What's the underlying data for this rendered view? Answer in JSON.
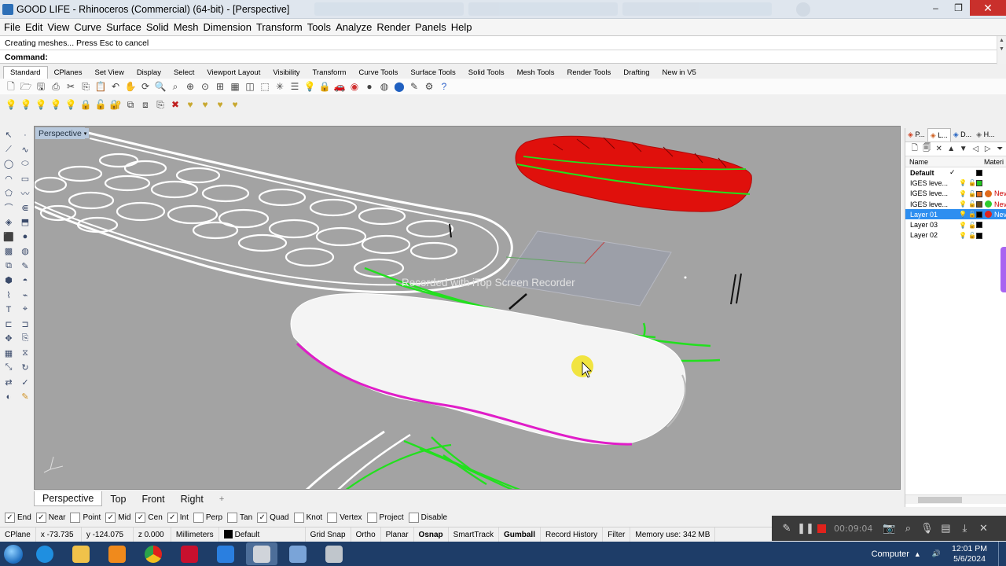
{
  "titlebar": {
    "title": "GOOD LIFE - Rhinoceros (Commercial) (64-bit) - [Perspective]"
  },
  "menu": [
    "File",
    "Edit",
    "View",
    "Curve",
    "Surface",
    "Solid",
    "Mesh",
    "Dimension",
    "Transform",
    "Tools",
    "Analyze",
    "Render",
    "Panels",
    "Help"
  ],
  "command": {
    "history": "Creating meshes... Press Esc to cancel",
    "prompt": "Command:",
    "value": ""
  },
  "toolbar_tabs": [
    "Standard",
    "CPlanes",
    "Set View",
    "Display",
    "Select",
    "Viewport Layout",
    "Visibility",
    "Transform",
    "Curve Tools",
    "Surface Tools",
    "Solid Tools",
    "Mesh Tools",
    "Render Tools",
    "Drafting",
    "New in V5"
  ],
  "active_toolbar_tab": "Standard",
  "viewport": {
    "name": "Perspective",
    "watermark": "Recorded with iTop Screen Recorder"
  },
  "viewport_tabs": [
    "Perspective",
    "Top",
    "Front",
    "Right"
  ],
  "active_viewport_tab": "Perspective",
  "panel": {
    "tabs": [
      "P...",
      "L...",
      "D...",
      "H..."
    ],
    "columns": {
      "name": "Name",
      "material": "Materi"
    },
    "layers": [
      {
        "name": "Default",
        "current": "✓",
        "color": "#000000",
        "material": "",
        "material_name": ""
      },
      {
        "name": "IGES leve...",
        "current": "",
        "color": "#22c51e",
        "material": "",
        "material_name": ""
      },
      {
        "name": "IGES leve...",
        "current": "",
        "color": "#e06a1c",
        "material": "#e06a1c",
        "material_name": "Nev"
      },
      {
        "name": "IGES leve...",
        "current": "",
        "color": "#6a4d1d",
        "material": "#2ecc2e",
        "material_name": "Nev"
      },
      {
        "name": "Layer 01",
        "current": "",
        "color": "#000000",
        "material": "#e0221c",
        "material_name": "Nev"
      },
      {
        "name": "Layer 03",
        "current": "",
        "color": "#000000",
        "material": "",
        "material_name": ""
      },
      {
        "name": "Layer 02",
        "current": "",
        "color": "#000000",
        "material": "",
        "material_name": ""
      }
    ],
    "selected_layer": "Layer 01"
  },
  "osnap": [
    {
      "label": "End",
      "checked": true
    },
    {
      "label": "Near",
      "checked": true
    },
    {
      "label": "Point",
      "checked": false
    },
    {
      "label": "Mid",
      "checked": true
    },
    {
      "label": "Cen",
      "checked": true
    },
    {
      "label": "Int",
      "checked": true
    },
    {
      "label": "Perp",
      "checked": false
    },
    {
      "label": "Tan",
      "checked": false
    },
    {
      "label": "Quad",
      "checked": true
    },
    {
      "label": "Knot",
      "checked": false
    },
    {
      "label": "Vertex",
      "checked": false
    },
    {
      "label": "Project",
      "checked": false
    },
    {
      "label": "Disable",
      "checked": false
    }
  ],
  "status": {
    "cplane": "CPlane",
    "x": "x -73.735",
    "y": "y -124.075",
    "z": "z 0.000",
    "units": "Millimeters",
    "layer": "Default",
    "grid_snap": "Grid Snap",
    "ortho": "Ortho",
    "planar": "Planar",
    "osnap": "Osnap",
    "smarttrack": "SmartTrack",
    "gumball": "Gumball",
    "record_history": "Record History",
    "filter": "Filter",
    "memory": "Memory use: 342 MB"
  },
  "recorder": {
    "time": "00:09:04"
  },
  "taskbar": {
    "computer": "Computer",
    "time": "12:01 PM",
    "date": "5/6/2024",
    "apps": [
      {
        "name": "ie-icon",
        "color": "#1f8fe0"
      },
      {
        "name": "folder-icon",
        "color": "#f0c24a"
      },
      {
        "name": "media-player-icon",
        "color": "#f08a1c"
      },
      {
        "name": "chrome-icon",
        "color": "#e0221c"
      },
      {
        "name": "recorder-app-icon",
        "color": "#c8102e"
      },
      {
        "name": "shield-app-icon",
        "color": "#2a7fe0"
      },
      {
        "name": "rhino-app-icon",
        "color": "#d0d4da"
      },
      {
        "name": "tool-app-icon",
        "color": "#7aa4d8"
      },
      {
        "name": "rhino-v5-app-icon",
        "color": "#c0c6cc"
      }
    ]
  },
  "colors": {
    "viewport_bg": "#a3a3a3",
    "selection": "#2d8ef0",
    "curve_green": "#22e01e",
    "solid_red": "#e0100c",
    "edge_magenta": "#e01ec8"
  }
}
